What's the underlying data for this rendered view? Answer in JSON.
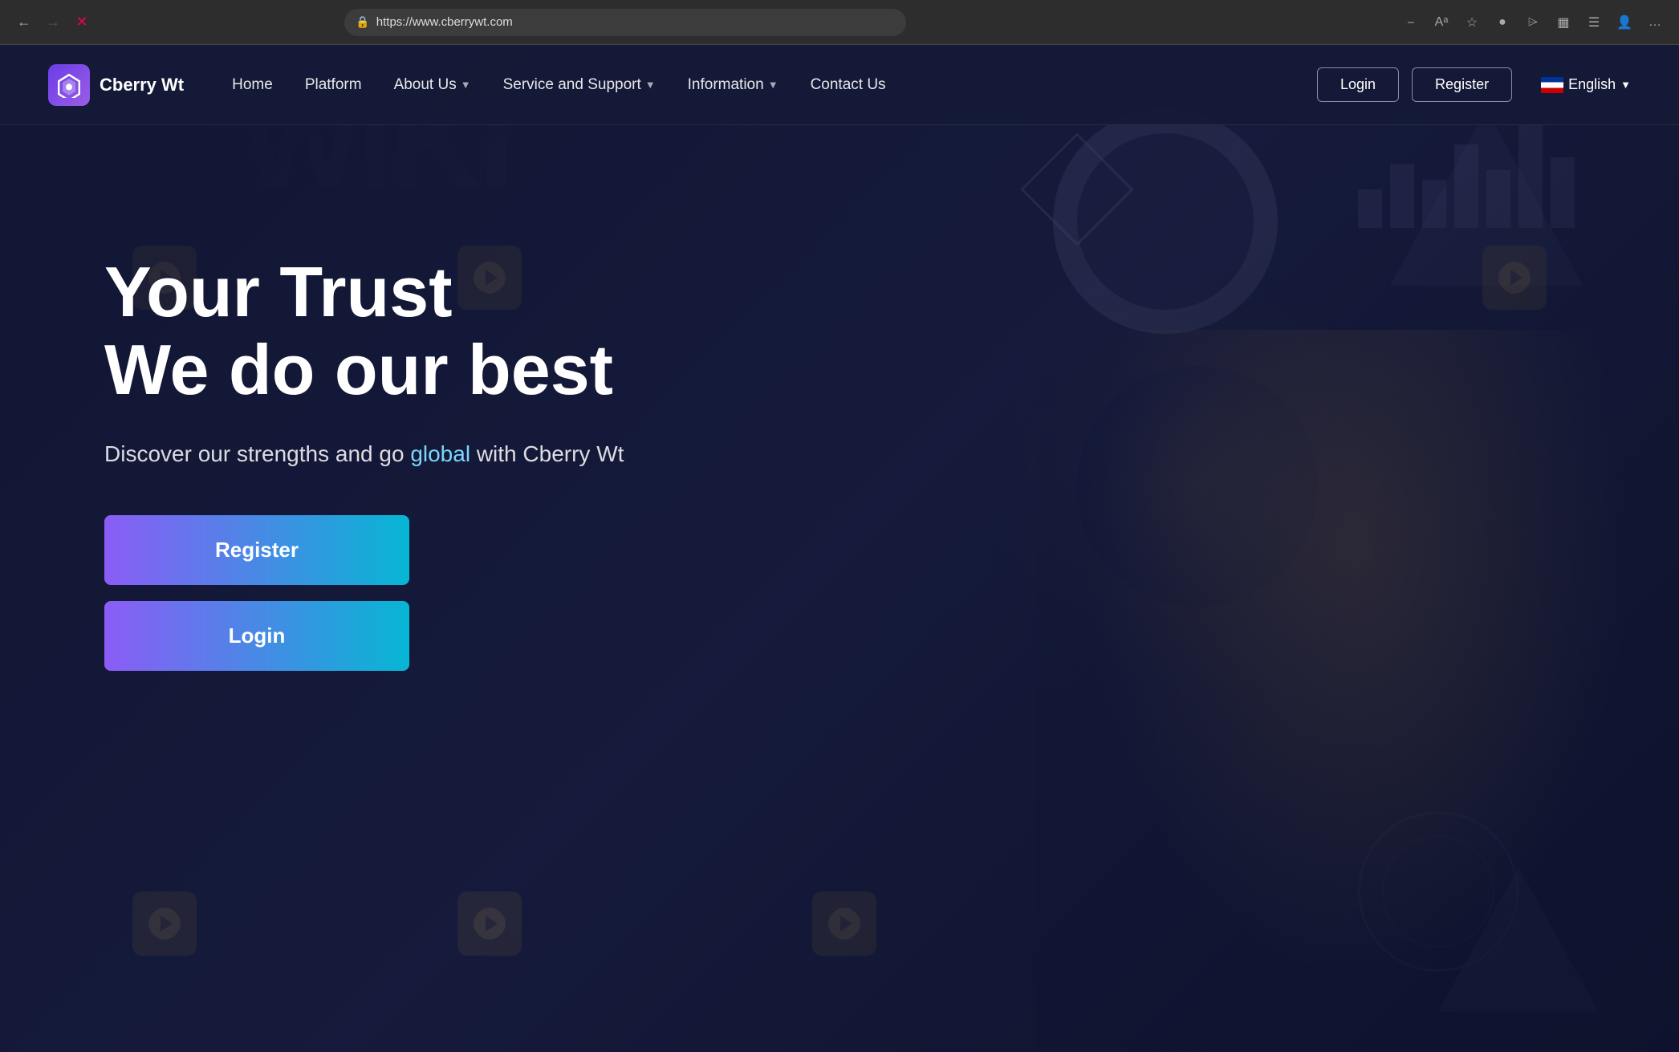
{
  "browser": {
    "url": "https://www.cberrywt.com",
    "back_button": "←",
    "close_button": "✕"
  },
  "navbar": {
    "logo_text": "Cberry Wt",
    "nav_items": [
      {
        "label": "Home",
        "has_dropdown": false
      },
      {
        "label": "Platform",
        "has_dropdown": false
      },
      {
        "label": "About Us",
        "has_dropdown": true
      },
      {
        "label": "Service and Support",
        "has_dropdown": true
      },
      {
        "label": "Information",
        "has_dropdown": true
      },
      {
        "label": "Contact Us",
        "has_dropdown": false
      }
    ],
    "login_label": "Login",
    "register_label": "Register",
    "language_label": "English"
  },
  "hero": {
    "title_line1": "Your Trust",
    "title_line2": "We do our best",
    "subtitle_prefix": "Discover our strengths and go ",
    "subtitle_highlight": "global",
    "subtitle_suffix": " with Cberry Wt",
    "btn_register": "Register",
    "btn_login": "Login"
  },
  "chart_bars": [
    60,
    100,
    75,
    130,
    90,
    160,
    110
  ],
  "colors": {
    "bg_dark": "#1a1f3a",
    "purple": "#8b5cf6",
    "cyan": "#06b6d4",
    "highlight": "#7dd4fc"
  }
}
